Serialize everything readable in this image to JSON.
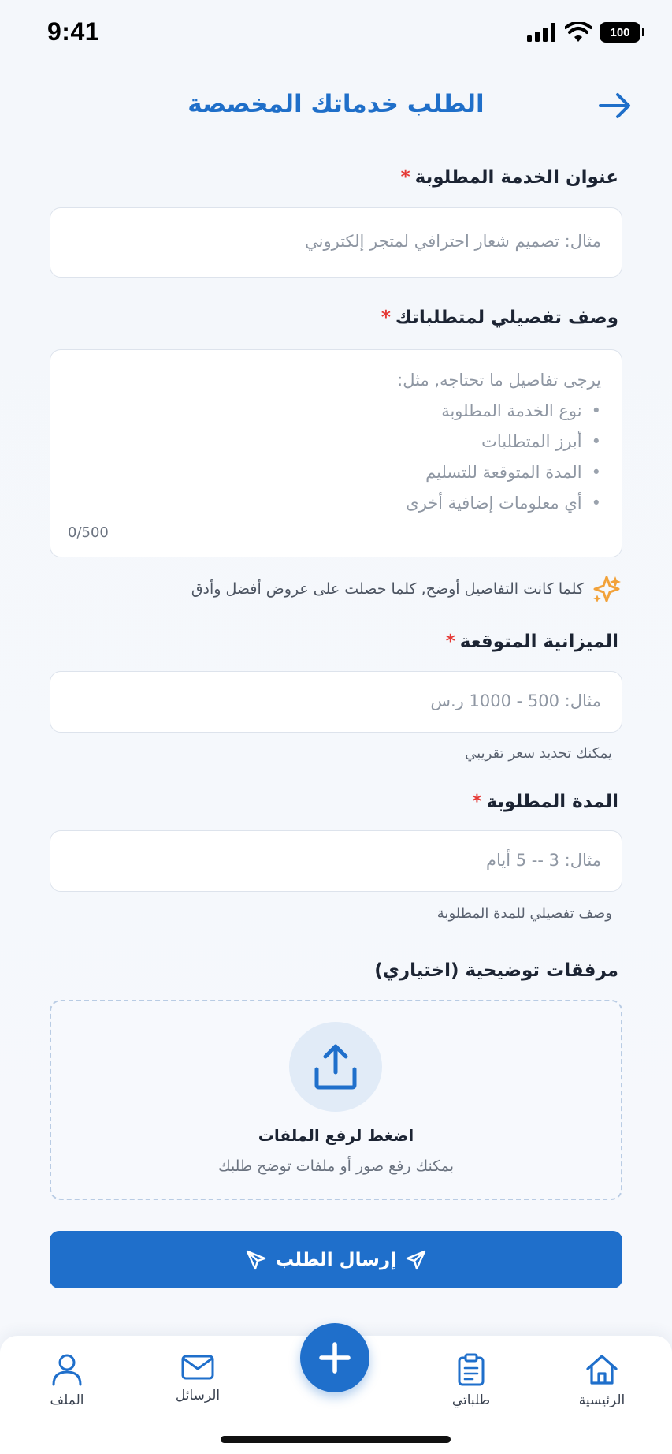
{
  "status_bar": {
    "time": "9:41",
    "battery": "100"
  },
  "header": {
    "title": "الطلب خدماتك المخصصة"
  },
  "fields": {
    "service_title": {
      "label": "عنوان الخدمة المطلوبة",
      "required_mark": "*",
      "placeholder": "مثال: تصميم شعار احترافي لمتجر إلكتروني"
    },
    "description": {
      "label": "وصف تفصيلي لمتطلباتك",
      "required_mark": "*",
      "placeholder_intro": "يرجى تفاصيل ما تحتاجه, مثل:",
      "placeholder_items": [
        "نوع الخدمة المطلوبة",
        "أبرز المتطلبات",
        "المدة المتوقعة للتسليم",
        "أي معلومات إضافية أخرى"
      ],
      "bullet": "•",
      "counter": "0/500"
    },
    "tip": "كلما كانت التفاصيل أوضح, كلما حصلت على عروض أفضل وأدق",
    "budget": {
      "label": "الميزانية المتوقعة",
      "required_mark": "*",
      "placeholder": "مثال: 500 - 1000 ر.س",
      "helper": "يمكنك تحديد سعر تقريبي"
    },
    "duration": {
      "label": "المدة المطلوبة",
      "required_mark": "*",
      "placeholder": "مثال: 3 -- 5 أيام",
      "helper": "وصف تفصيلي للمدة المطلوبة"
    },
    "attachments": {
      "label": "مرفقات توضيحية (اختياري)",
      "upload_title": "اضغط لرفع الملفات",
      "upload_subtitle": "بمكنك رفع صور أو ملفات توضح طلبك"
    }
  },
  "submit": {
    "label": "إرسال الطلب"
  },
  "bottom_nav": {
    "home": "الرئيسية",
    "orders": "طلباتي",
    "messages": "الرسائل",
    "profile": "الملف"
  },
  "colors": {
    "primary": "#1f6fcb",
    "required": "#e53935",
    "accent_icon": "#f2a23a"
  }
}
